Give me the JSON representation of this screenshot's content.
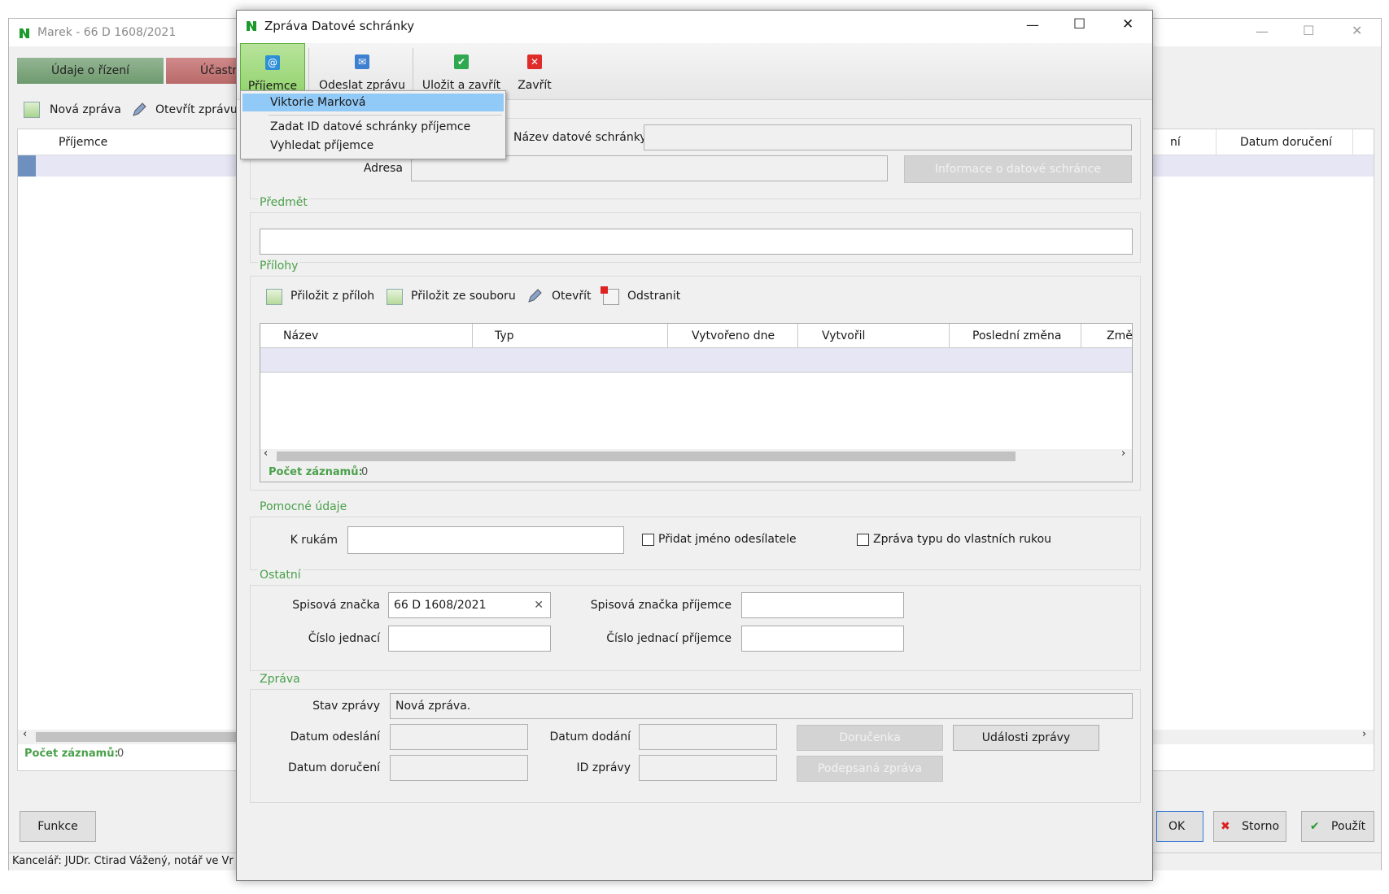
{
  "background_window": {
    "title": "Marek - 66 D 1608/2021",
    "tabs": [
      "Údaje o řízení",
      "Účastní"
    ],
    "toolbar": {
      "new_message": "Nová zpráva",
      "open_message": "Otevřít zprávu"
    },
    "columns": {
      "recipient": "Příjemce",
      "partial": "ní",
      "delivered": "Datum doručení"
    },
    "record_count_label": "Počet záznamů:",
    "record_count_value": "0",
    "buttons": {
      "functions": "Funkce",
      "ok": "OK",
      "cancel": "Storno",
      "apply": "Použít"
    },
    "status_bar": "Kancelář: JUDr. Ctirad Vážený, notář ve Vr"
  },
  "dialog": {
    "title": "Zpráva Datové schránky",
    "ribbon": {
      "recipient": "Příjemce",
      "send": "Odeslat zprávu",
      "save_close": "Uložit a zavřít",
      "close": "Zavřít"
    },
    "recipient_menu": {
      "items": [
        "Viktorie Marková",
        "Zadat ID datové schránky příjemce",
        "Vyhledat příjemce"
      ]
    },
    "recipient_group": {
      "databox_name_label": "Název datové schránky",
      "databox_name_value": "",
      "address_label": "Adresa",
      "address_value": "",
      "info_button": "Informace o datové schránce"
    },
    "subject": {
      "label": "Předmět",
      "value": ""
    },
    "attachments": {
      "label": "Přílohy",
      "toolbar": {
        "attach_from_attachments": "Přiložit z příloh",
        "attach_from_file": "Přiložit ze souboru",
        "open": "Otevřít",
        "remove": "Odstranit"
      },
      "columns": [
        "Název",
        "Typ",
        "Vytvořeno dne",
        "Vytvořil",
        "Poslední změna",
        "Změ"
      ],
      "record_count_label": "Počet záznamů:",
      "record_count_value": "0"
    },
    "auxiliary": {
      "label": "Pomocné údaje",
      "attention_label": "K rukám",
      "attention_value": "",
      "add_sender_name": "Přidat jméno odesílatele",
      "own_hands": "Zpráva typu do vlastních rukou"
    },
    "other": {
      "label": "Ostatní",
      "file_ref_label": "Spisová značka",
      "file_ref_value": "66 D 1608/2021",
      "recipient_file_ref_label": "Spisová značka příjemce",
      "recipient_file_ref_value": "",
      "ref_number_label": "Číslo jednací",
      "ref_number_value": "",
      "recipient_ref_number_label": "Číslo jednací příjemce",
      "recipient_ref_number_value": ""
    },
    "message": {
      "label": "Zpráva",
      "state_label": "Stav zprávy",
      "state_value": "Nová zpráva.",
      "sent_date_label": "Datum odeslání",
      "sent_date_value": "",
      "delivered_date_label": "Datum dodání",
      "delivered_date_value": "",
      "receipt_button": "Doručenka",
      "events_button": "Události zprávy",
      "delivery_date_label": "Datum doručení",
      "delivery_date_value": "",
      "message_id_label": "ID zprávy",
      "message_id_value": "",
      "signed_button": "Podepsaná zpráva"
    }
  },
  "colors": {
    "accent_green": "#4aa04a",
    "menu_highlight": "#91c9f7",
    "selected_row": "#e6e6f5"
  }
}
